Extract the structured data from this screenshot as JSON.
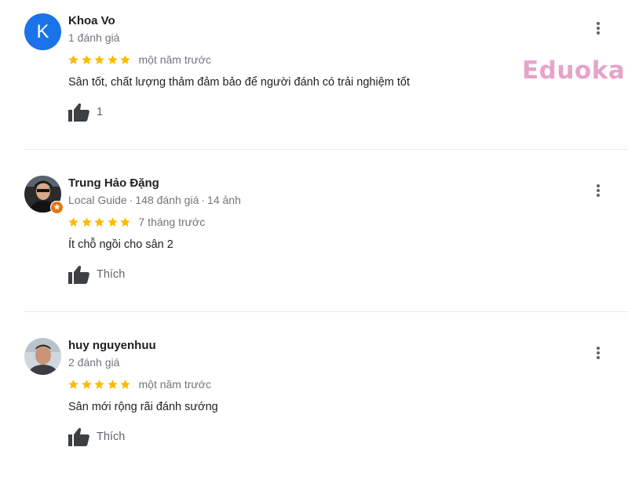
{
  "watermark": {
    "text": "Eduoka"
  },
  "colors": {
    "star": "#fbbc04",
    "text_primary": "#202124",
    "text_secondary": "#70757a",
    "avatar_blue": "#1a73e8",
    "local_guide_badge": "#e8710a",
    "watermark": "#e6a4ca"
  },
  "reviews": [
    {
      "author": "Khoa Vo",
      "avatar": {
        "type": "letter",
        "letter": "K"
      },
      "meta": {
        "guide": "",
        "review_count": "1 đánh giá",
        "photo_count": ""
      },
      "rating": 5,
      "time": "một năm trước",
      "text": "Sân tốt, chất lượng thảm đảm bảo để người đánh có trải nghiệm tốt",
      "like_label": "1",
      "icons": {
        "like": "thumbs-up-icon",
        "menu": "more-vert-icon"
      }
    },
    {
      "author": "Trung Hảo Đặng",
      "avatar": {
        "type": "photo",
        "letter": ""
      },
      "meta": {
        "guide": "Local Guide",
        "review_count": "148 đánh giá",
        "photo_count": "14 ảnh"
      },
      "rating": 5,
      "time": "7 tháng trước",
      "text": "Ít chỗ ngồi cho sân 2",
      "like_label": "Thích",
      "icons": {
        "like": "thumbs-up-icon",
        "menu": "more-vert-icon"
      }
    },
    {
      "author": "huy nguyenhuu",
      "avatar": {
        "type": "photo",
        "letter": ""
      },
      "meta": {
        "guide": "",
        "review_count": "2 đánh giá",
        "photo_count": ""
      },
      "rating": 5,
      "time": "một năm trước",
      "text": "Sân mới rộng rãi đánh sướng",
      "like_label": "Thích",
      "icons": {
        "like": "thumbs-up-icon",
        "menu": "more-vert-icon"
      }
    }
  ]
}
